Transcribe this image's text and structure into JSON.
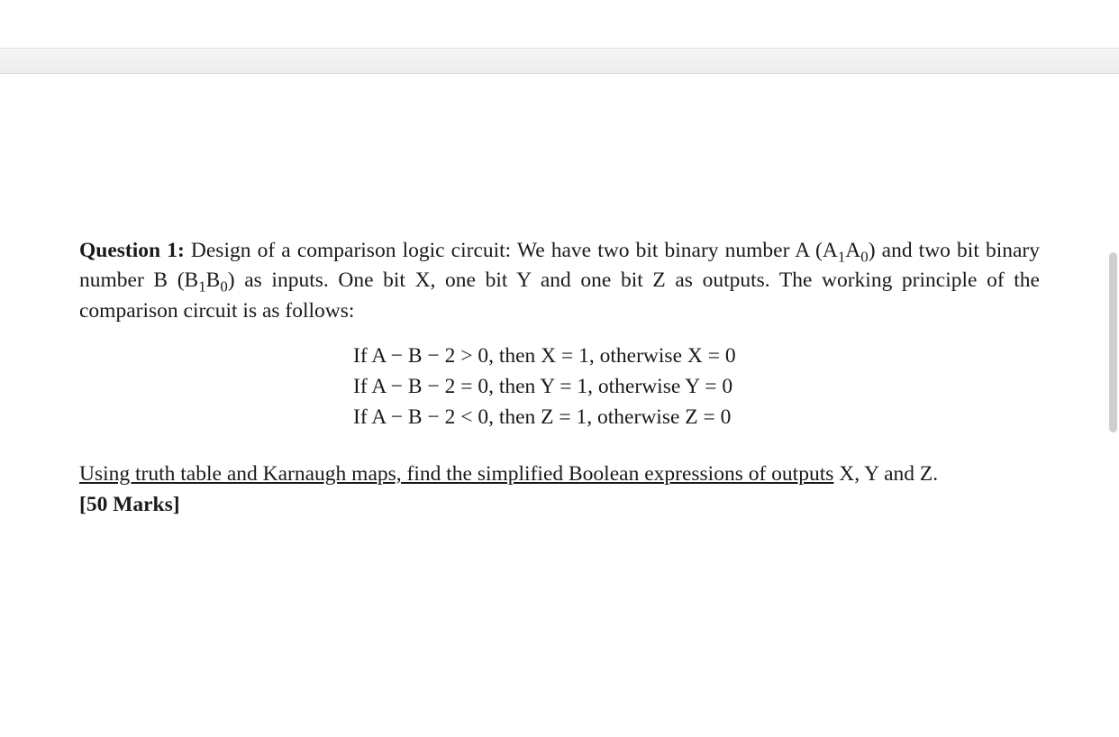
{
  "question": {
    "label": "Question 1:",
    "intro_part1": " Design of a comparison logic circuit: We have two bit binary number A (A",
    "sub_a1": "1",
    "intro_part2": "A",
    "sub_a0": "0",
    "intro_part3": ") and two bit binary number B (B",
    "sub_b1": "1",
    "intro_part4": "B",
    "sub_b0": "0",
    "intro_part5": ") as inputs. One bit X, one bit Y and one bit Z as outputs. The working principle of the comparison circuit is as follows:"
  },
  "conditions": {
    "line1": "If A − B − 2 > 0, then X = 1, otherwise X = 0",
    "line2": "If A − B − 2 = 0, then Y = 1, otherwise Y = 0",
    "line3": "If A − B − 2 < 0, then Z = 1, otherwise Z = 0"
  },
  "task": {
    "underlined": "Using truth table and Karnaugh maps, find the simplified Boolean expressions of outputs",
    "trailing": "  X, Y and Z. ",
    "marks": "[50 Marks]"
  }
}
